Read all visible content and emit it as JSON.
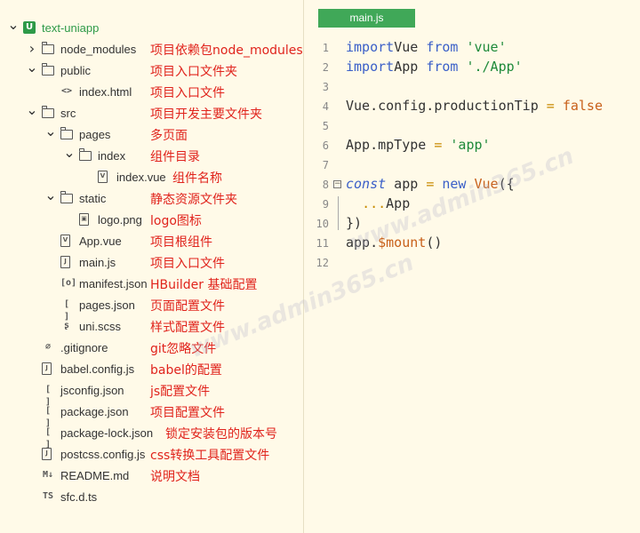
{
  "explorer": {
    "items": [
      {
        "name": "text-uniapp",
        "note": "",
        "indent": 0,
        "arrow": "open",
        "icon": "root-project-icon",
        "glyph": "U",
        "root": true
      },
      {
        "name": "node_modules",
        "note": "项目依赖包node_modules",
        "indent": 1,
        "arrow": "closed",
        "icon": "folder-icon"
      },
      {
        "name": "public",
        "note": "项目入口文件夹",
        "indent": 1,
        "arrow": "open",
        "icon": "folder-icon"
      },
      {
        "name": "index.html",
        "note": "项目入口文件",
        "indent": 2,
        "arrow": "",
        "icon": "html-file-icon",
        "glyph": "<>"
      },
      {
        "name": "src",
        "note": "项目开发主要文件夹",
        "indent": 1,
        "arrow": "open",
        "icon": "folder-icon"
      },
      {
        "name": "pages",
        "note": "多页面",
        "indent": 2,
        "arrow": "open",
        "icon": "folder-icon"
      },
      {
        "name": "index",
        "note": "组件目录",
        "indent": 3,
        "arrow": "open",
        "icon": "folder-icon"
      },
      {
        "name": "index.vue",
        "note": "组件名称",
        "indent": 4,
        "arrow": "",
        "icon": "vue-file-icon",
        "glyph": "V"
      },
      {
        "name": "static",
        "note": "静态资源文件夹",
        "indent": 2,
        "arrow": "open",
        "icon": "folder-icon"
      },
      {
        "name": "logo.png",
        "note": "logo图标",
        "indent": 3,
        "arrow": "",
        "icon": "image-file-icon",
        "glyph": "▣"
      },
      {
        "name": "App.vue",
        "note": "项目根组件",
        "indent": 2,
        "arrow": "",
        "icon": "vue-file-icon",
        "glyph": "V"
      },
      {
        "name": "main.js",
        "note": "项目入口文件",
        "indent": 2,
        "arrow": "",
        "icon": "js-file-icon",
        "glyph": "J"
      },
      {
        "name": "manifest.json",
        "note": "HBuilder 基础配置",
        "indent": 2,
        "arrow": "",
        "icon": "manifest-file-icon",
        "glyph": "[o]"
      },
      {
        "name": "pages.json",
        "note": "页面配置文件",
        "indent": 2,
        "arrow": "",
        "icon": "json-file-icon",
        "glyph": "[ ]"
      },
      {
        "name": "uni.scss",
        "note": "样式配置文件",
        "indent": 2,
        "arrow": "",
        "icon": "scss-file-icon",
        "glyph": "ʂ"
      },
      {
        "name": ".gitignore",
        "note": "git忽略文件",
        "indent": 1,
        "arrow": "",
        "icon": "git-file-icon",
        "glyph": "⌀"
      },
      {
        "name": "babel.config.js",
        "note": "babel的配置",
        "indent": 1,
        "arrow": "",
        "icon": "js-file-icon",
        "glyph": "J"
      },
      {
        "name": "jsconfig.json",
        "note": "js配置文件",
        "indent": 1,
        "arrow": "",
        "icon": "json-file-icon",
        "glyph": "[ ]"
      },
      {
        "name": "package.json",
        "note": "项目配置文件",
        "indent": 1,
        "arrow": "",
        "icon": "json-file-icon",
        "glyph": "[ ]"
      },
      {
        "name": "package-lock.json",
        "note": "锁定安装包的版本号",
        "indent": 1,
        "arrow": "",
        "icon": "json-file-icon",
        "glyph": "[ ]"
      },
      {
        "name": "postcss.config.js",
        "note": "css转换工具配置文件",
        "indent": 1,
        "arrow": "",
        "icon": "js-file-icon",
        "glyph": "J"
      },
      {
        "name": "README.md",
        "note": "说明文档",
        "indent": 1,
        "arrow": "",
        "icon": "markdown-file-icon",
        "glyph": "M↓"
      },
      {
        "name": "sfc.d.ts",
        "note": "",
        "indent": 1,
        "arrow": "",
        "icon": "ts-file-icon",
        "glyph": "TS"
      }
    ]
  },
  "editor": {
    "tab_label": "main.js",
    "lines": [
      {
        "n": "1",
        "tokens": [
          [
            "kw",
            "import"
          ],
          [
            "",
            "Vue "
          ],
          [
            "kw",
            "from"
          ],
          [
            "",
            " "
          ],
          [
            "str",
            "'vue'"
          ]
        ]
      },
      {
        "n": "2",
        "tokens": [
          [
            "kw",
            "import"
          ],
          [
            "",
            "App "
          ],
          [
            "kw",
            "from"
          ],
          [
            "",
            " "
          ],
          [
            "str",
            "'./App'"
          ]
        ]
      },
      {
        "n": "3",
        "tokens": []
      },
      {
        "n": "4",
        "tokens": [
          [
            "",
            "Vue.config.productionTip "
          ],
          [
            "op",
            "="
          ],
          [
            "",
            " "
          ],
          [
            "bool",
            "false"
          ]
        ]
      },
      {
        "n": "5",
        "tokens": []
      },
      {
        "n": "6",
        "tokens": [
          [
            "",
            "App.mpType "
          ],
          [
            "op",
            "="
          ],
          [
            "",
            " "
          ],
          [
            "str",
            "'app'"
          ]
        ]
      },
      {
        "n": "7",
        "tokens": []
      },
      {
        "n": "8",
        "tokens": [
          [
            "kw ital",
            "const"
          ],
          [
            "",
            " app "
          ],
          [
            "op",
            "="
          ],
          [
            "",
            " "
          ],
          [
            "kw",
            "new"
          ],
          [
            "",
            " "
          ],
          [
            "bool",
            "Vue"
          ],
          [
            "",
            "({"
          ]
        ],
        "fold": true
      },
      {
        "n": "9",
        "tokens": [
          [
            "",
            "  "
          ],
          [
            "op",
            "..."
          ],
          [
            "",
            "App"
          ]
        ]
      },
      {
        "n": "10",
        "tokens": [
          [
            "",
            "})"
          ]
        ]
      },
      {
        "n": "11",
        "tokens": [
          [
            "",
            "app."
          ],
          [
            "bool",
            "$mount"
          ],
          [
            "",
            "()"
          ]
        ]
      },
      {
        "n": "12",
        "tokens": []
      }
    ]
  },
  "watermark": "www.admin365.cn"
}
